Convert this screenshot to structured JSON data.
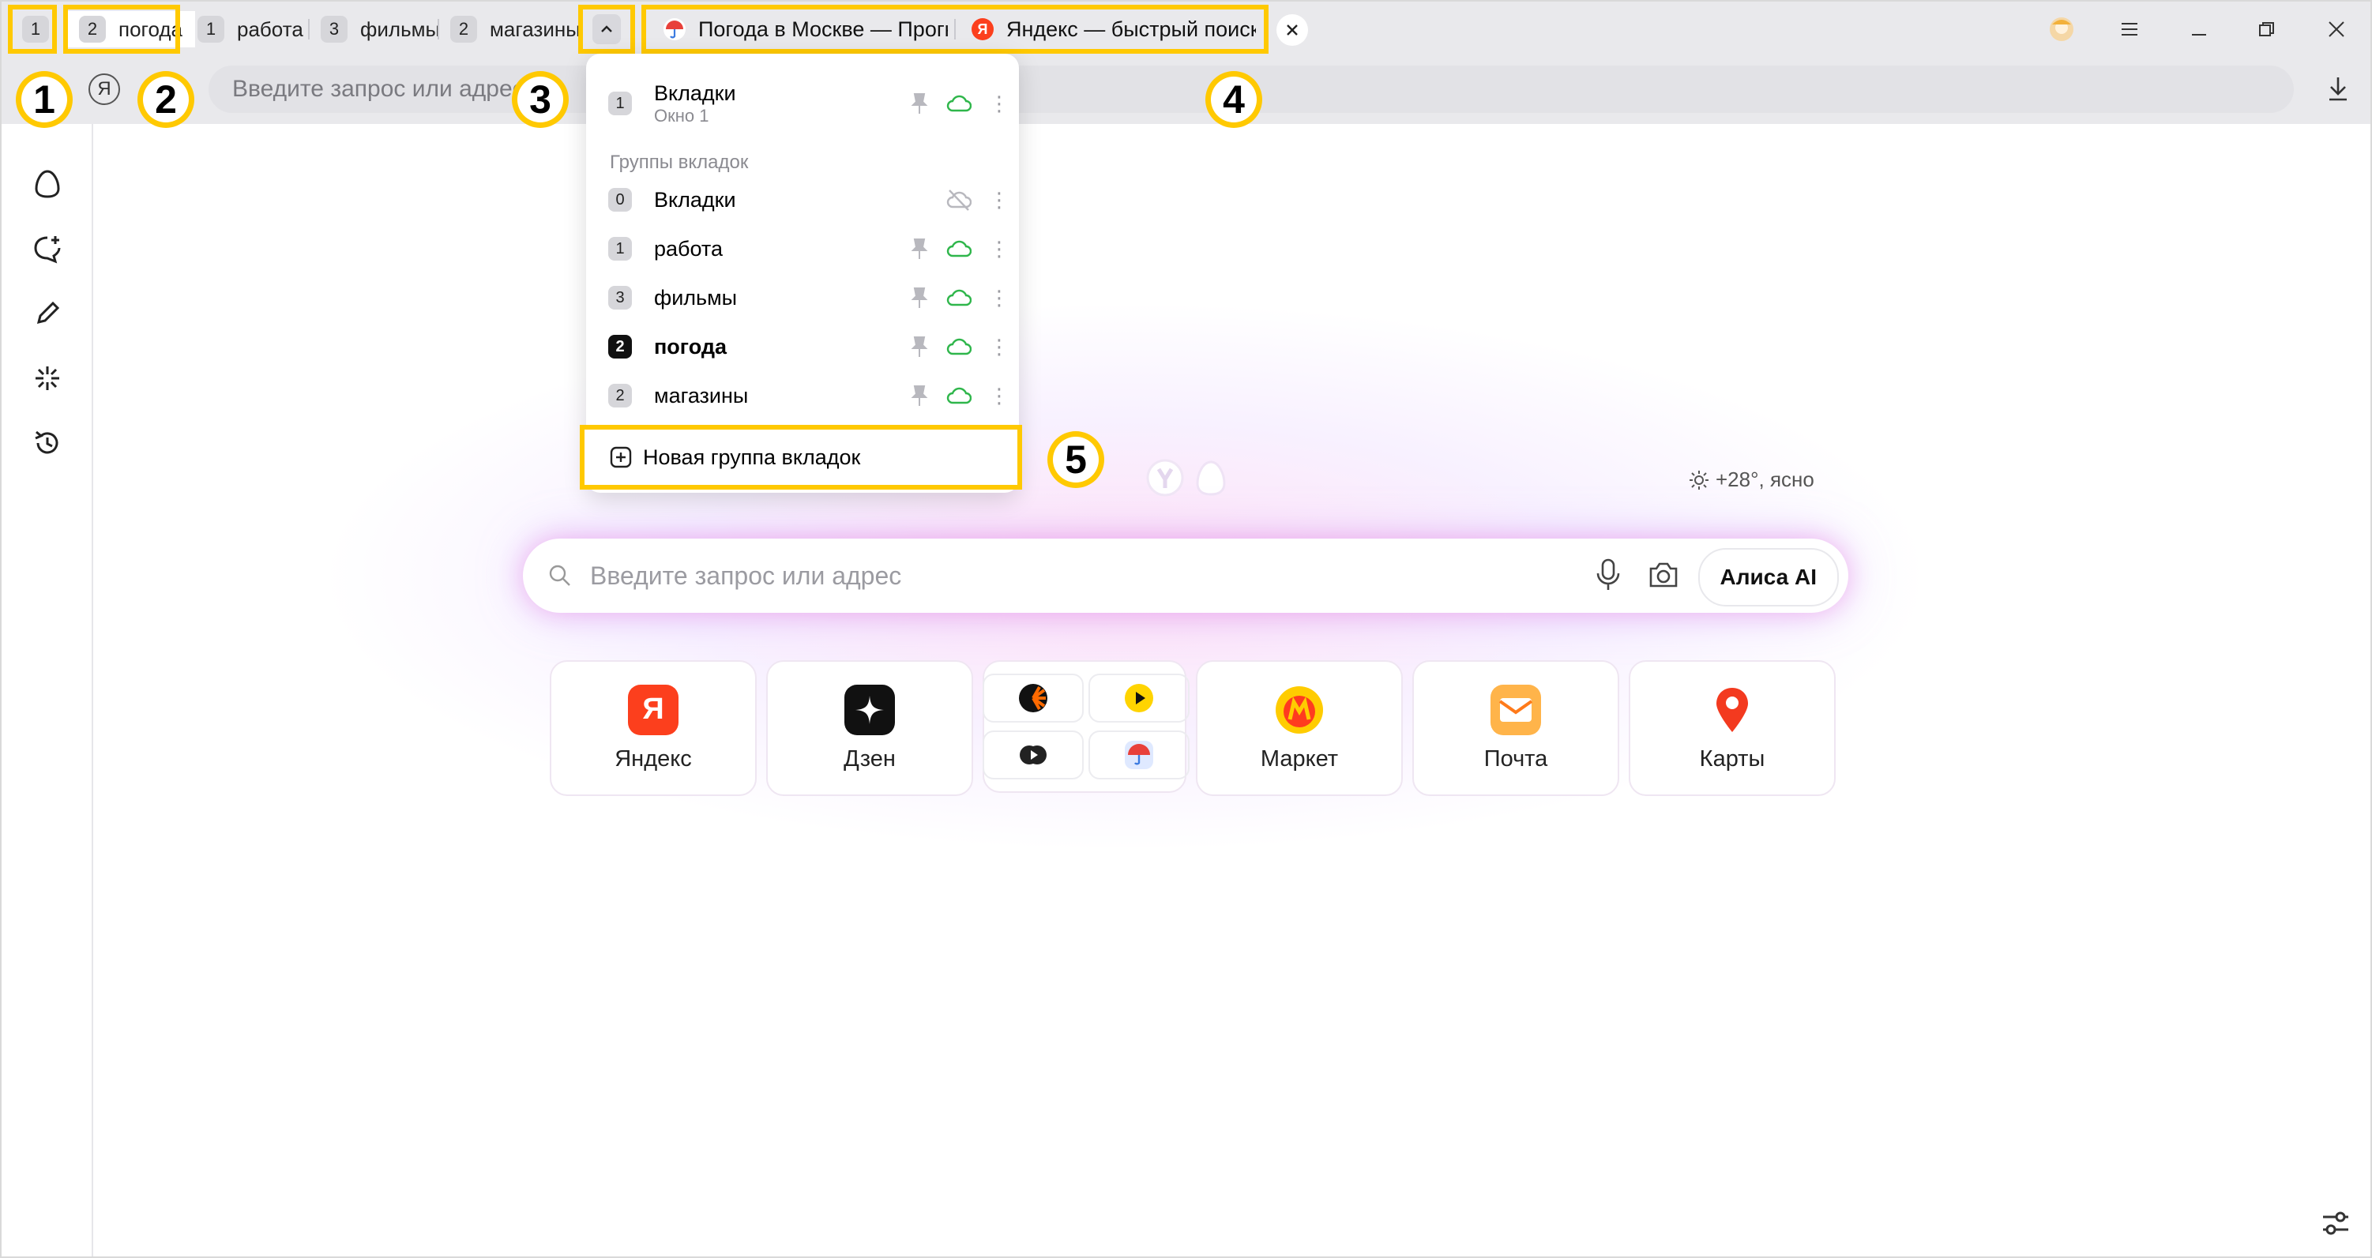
{
  "tabstrip": {
    "groups": [
      {
        "count": "1",
        "label": ""
      },
      {
        "count": "2",
        "label": "погода"
      },
      {
        "count": "1",
        "label": "работа"
      },
      {
        "count": "3",
        "label": "фильмы"
      },
      {
        "count": "2",
        "label": "магазины"
      }
    ],
    "collapse_icon": "chevron-up-icon",
    "tabs": [
      {
        "title": "Погода в Москве — Прогн",
        "icon": "umbrella-icon"
      },
      {
        "title": "Яндекс — быстрый поиск",
        "icon": "yandex-icon"
      }
    ]
  },
  "window": {
    "profile_icon": "avatar-icon",
    "menu_icon": "hamburger-icon"
  },
  "address": {
    "placeholder": "Введите запрос или адрес"
  },
  "callouts": [
    "1",
    "2",
    "3",
    "4",
    "5"
  ],
  "menu": {
    "window_item": {
      "count": "1",
      "title": "Вкладки",
      "subtitle": "Окно 1"
    },
    "groups_caption": "Группы вкладок",
    "groups": [
      {
        "count": "0",
        "title": "Вкладки",
        "synced": false,
        "pinned": false
      },
      {
        "count": "1",
        "title": "работа",
        "synced": true,
        "pinned": true
      },
      {
        "count": "3",
        "title": "фильмы",
        "synced": true,
        "pinned": true
      },
      {
        "count": "2",
        "title": "погода",
        "synced": true,
        "pinned": true,
        "current": true
      },
      {
        "count": "2",
        "title": "магазины",
        "synced": true,
        "pinned": true
      }
    ],
    "new_group": "Новая группа вкладок"
  },
  "weather": {
    "text": "+28°, ясно"
  },
  "search": {
    "placeholder": "Введите запрос или адрес",
    "alice_button": "Алиса AI"
  },
  "tiles": [
    {
      "label": "Яндекс",
      "icon": "yandex-icon"
    },
    {
      "label": "Дзен",
      "icon": "dzen-icon"
    },
    {
      "label": "",
      "icon": "services-group-icon"
    },
    {
      "label": "Маркет",
      "icon": "market-icon"
    },
    {
      "label": "Почта",
      "icon": "mail-icon"
    },
    {
      "label": "Карты",
      "icon": "maps-icon"
    }
  ],
  "colors": {
    "highlight": "#ffc901",
    "sync_green": "#2fb64b",
    "yandex_red": "#fc3f1d"
  }
}
